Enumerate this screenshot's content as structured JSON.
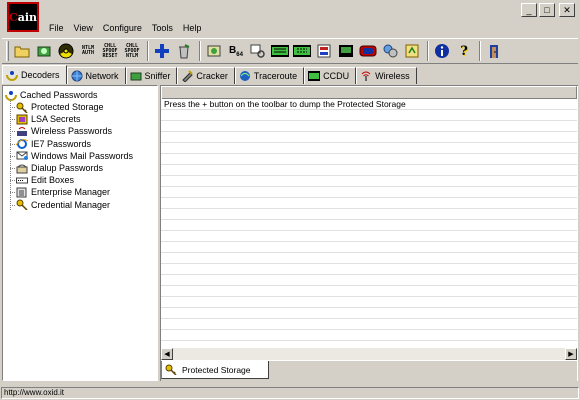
{
  "app": {
    "logo_text": "ain",
    "logo_prefix": "C"
  },
  "window_buttons": {
    "minimize": "_",
    "maximize": "□",
    "close": "✕"
  },
  "menu": [
    "File",
    "View",
    "Configure",
    "Tools",
    "Help"
  ],
  "toolbar": {
    "ntlm_auth": [
      "NTLM",
      "AUTH"
    ],
    "chall_spoof_reset": [
      "CHLL",
      "SPOOF",
      "RESET"
    ],
    "chall_spoof_ntlm": [
      "CHLL",
      "SPOOF",
      "NTLM"
    ],
    "base64_label": "B",
    "base64_sub": "64"
  },
  "tabs": [
    {
      "label": "Decoders",
      "icon": "decoder-icon"
    },
    {
      "label": "Network",
      "icon": "network-icon"
    },
    {
      "label": "Sniffer",
      "icon": "sniffer-icon"
    },
    {
      "label": "Cracker",
      "icon": "cracker-icon"
    },
    {
      "label": "Traceroute",
      "icon": "traceroute-icon"
    },
    {
      "label": "CCDU",
      "icon": "ccdu-icon"
    },
    {
      "label": "Wireless",
      "icon": "wireless-icon"
    }
  ],
  "tree": {
    "root": "Cached Passwords",
    "items": [
      "Protected Storage",
      "LSA Secrets",
      "Wireless Passwords",
      "IE7 Passwords",
      "Windows Mail Passwords",
      "Dialup Passwords",
      "Edit Boxes",
      "Enterprise Manager",
      "Credential Manager"
    ]
  },
  "content": {
    "message": "Press the + button on the toolbar to dump the Protected Storage"
  },
  "bottom_tab": {
    "label": "Protected Storage"
  },
  "status": {
    "text": "http://www.oxid.it"
  },
  "colors": {
    "accent_blue": "#000080",
    "logo_red": "#c00000",
    "face": "#d4d0c8"
  }
}
